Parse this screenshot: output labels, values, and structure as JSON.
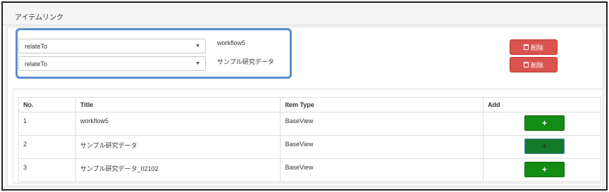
{
  "panel": {
    "title": "アイテムリンク"
  },
  "relations": [
    {
      "type": "relateTo",
      "label": "workflow5",
      "delete_label": "削除"
    },
    {
      "type": "relateTo",
      "label": "サンプル研究データ",
      "delete_label": "削除"
    }
  ],
  "table": {
    "headers": [
      "No.",
      "Title",
      "Item Type",
      "Add"
    ],
    "rows": [
      {
        "no": "1",
        "title": "workflow5",
        "item_type": "BaseView",
        "add": "+"
      },
      {
        "no": "2",
        "title": "サンプル研究データ",
        "item_type": "BaseView",
        "add": "+"
      },
      {
        "no": "3",
        "title": "サンプル研究データ_02102",
        "item_type": "BaseView",
        "add": "+"
      }
    ]
  },
  "colors": {
    "delete": "#d9534f",
    "add": "#138c13",
    "highlight": "#5b8fc9"
  },
  "icons": {
    "delete": "trash-icon",
    "select": "caret-down-icon"
  }
}
